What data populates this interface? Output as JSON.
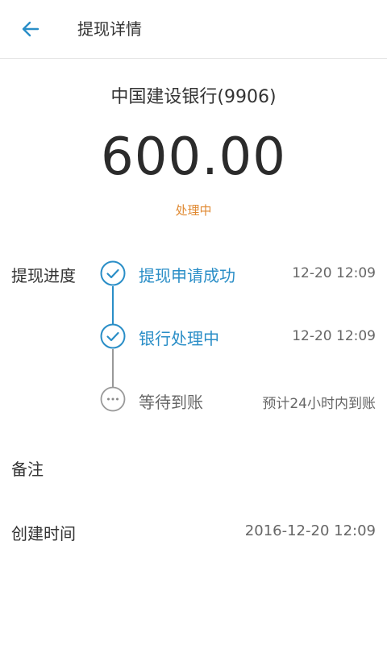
{
  "header": {
    "title": "提现详情",
    "back_icon": "arrow-left-icon"
  },
  "summary": {
    "bank": "中国建设银行(9906)",
    "amount": "600.00",
    "status": "处理中",
    "status_color": "#e08a33"
  },
  "progress": {
    "label": "提现进度",
    "accent_color": "#2a8ec7",
    "steps": [
      {
        "label": "提现申请成功",
        "time": "12-20 12:09",
        "state": "done",
        "icon": "check-circle-icon"
      },
      {
        "label": "银行处理中",
        "time": "12-20 12:09",
        "state": "done",
        "icon": "check-circle-icon"
      },
      {
        "label": "等待到账",
        "time": "预计24小时内到账",
        "state": "pending",
        "icon": "more-circle-icon"
      }
    ]
  },
  "remark": {
    "label": "备注",
    "value": ""
  },
  "created": {
    "label": "创建时间",
    "value": "2016-12-20 12:09"
  }
}
